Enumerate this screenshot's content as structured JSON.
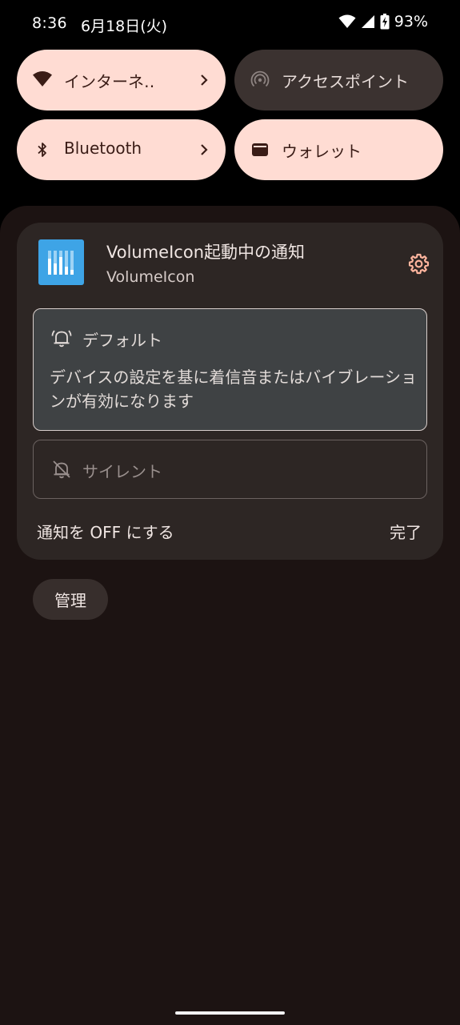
{
  "status_bar": {
    "time": "8:36",
    "date": "6月18日(火)",
    "battery_percent": "93%"
  },
  "quick_settings": {
    "tiles": [
      {
        "label": "インターネ‥",
        "state": "on",
        "icon": "wifi-icon",
        "has_chevron": true
      },
      {
        "label": "アクセスポイント",
        "state": "off",
        "icon": "hotspot-icon",
        "has_chevron": false
      },
      {
        "label": "Bluetooth",
        "state": "on",
        "icon": "bluetooth-icon",
        "has_chevron": true
      },
      {
        "label": "ウォレット",
        "state": "on",
        "icon": "wallet-icon",
        "has_chevron": false
      }
    ]
  },
  "notification": {
    "title": "VolumeIcon起動中の通知",
    "app_name": "VolumeIcon",
    "settings_icon": "gear-icon",
    "options": [
      {
        "label": "デフォルト",
        "description": "デバイスの設定を基に着信音またはバイブレーションが有効になります",
        "icon": "bell-icon",
        "selected": true
      },
      {
        "label": "サイレント",
        "icon": "bell-off-icon",
        "selected": false
      }
    ],
    "turn_off_label": "通知を OFF にする",
    "done_label": "完了"
  },
  "manage_label": "管理",
  "colors": {
    "tile_on": "#ffdcd3",
    "tile_off": "#3b3230",
    "shade_background": "#1c1312",
    "card_background": "#2d2624",
    "accent_gear": "#ffb59e",
    "app_icon": "#3ea4e6"
  }
}
